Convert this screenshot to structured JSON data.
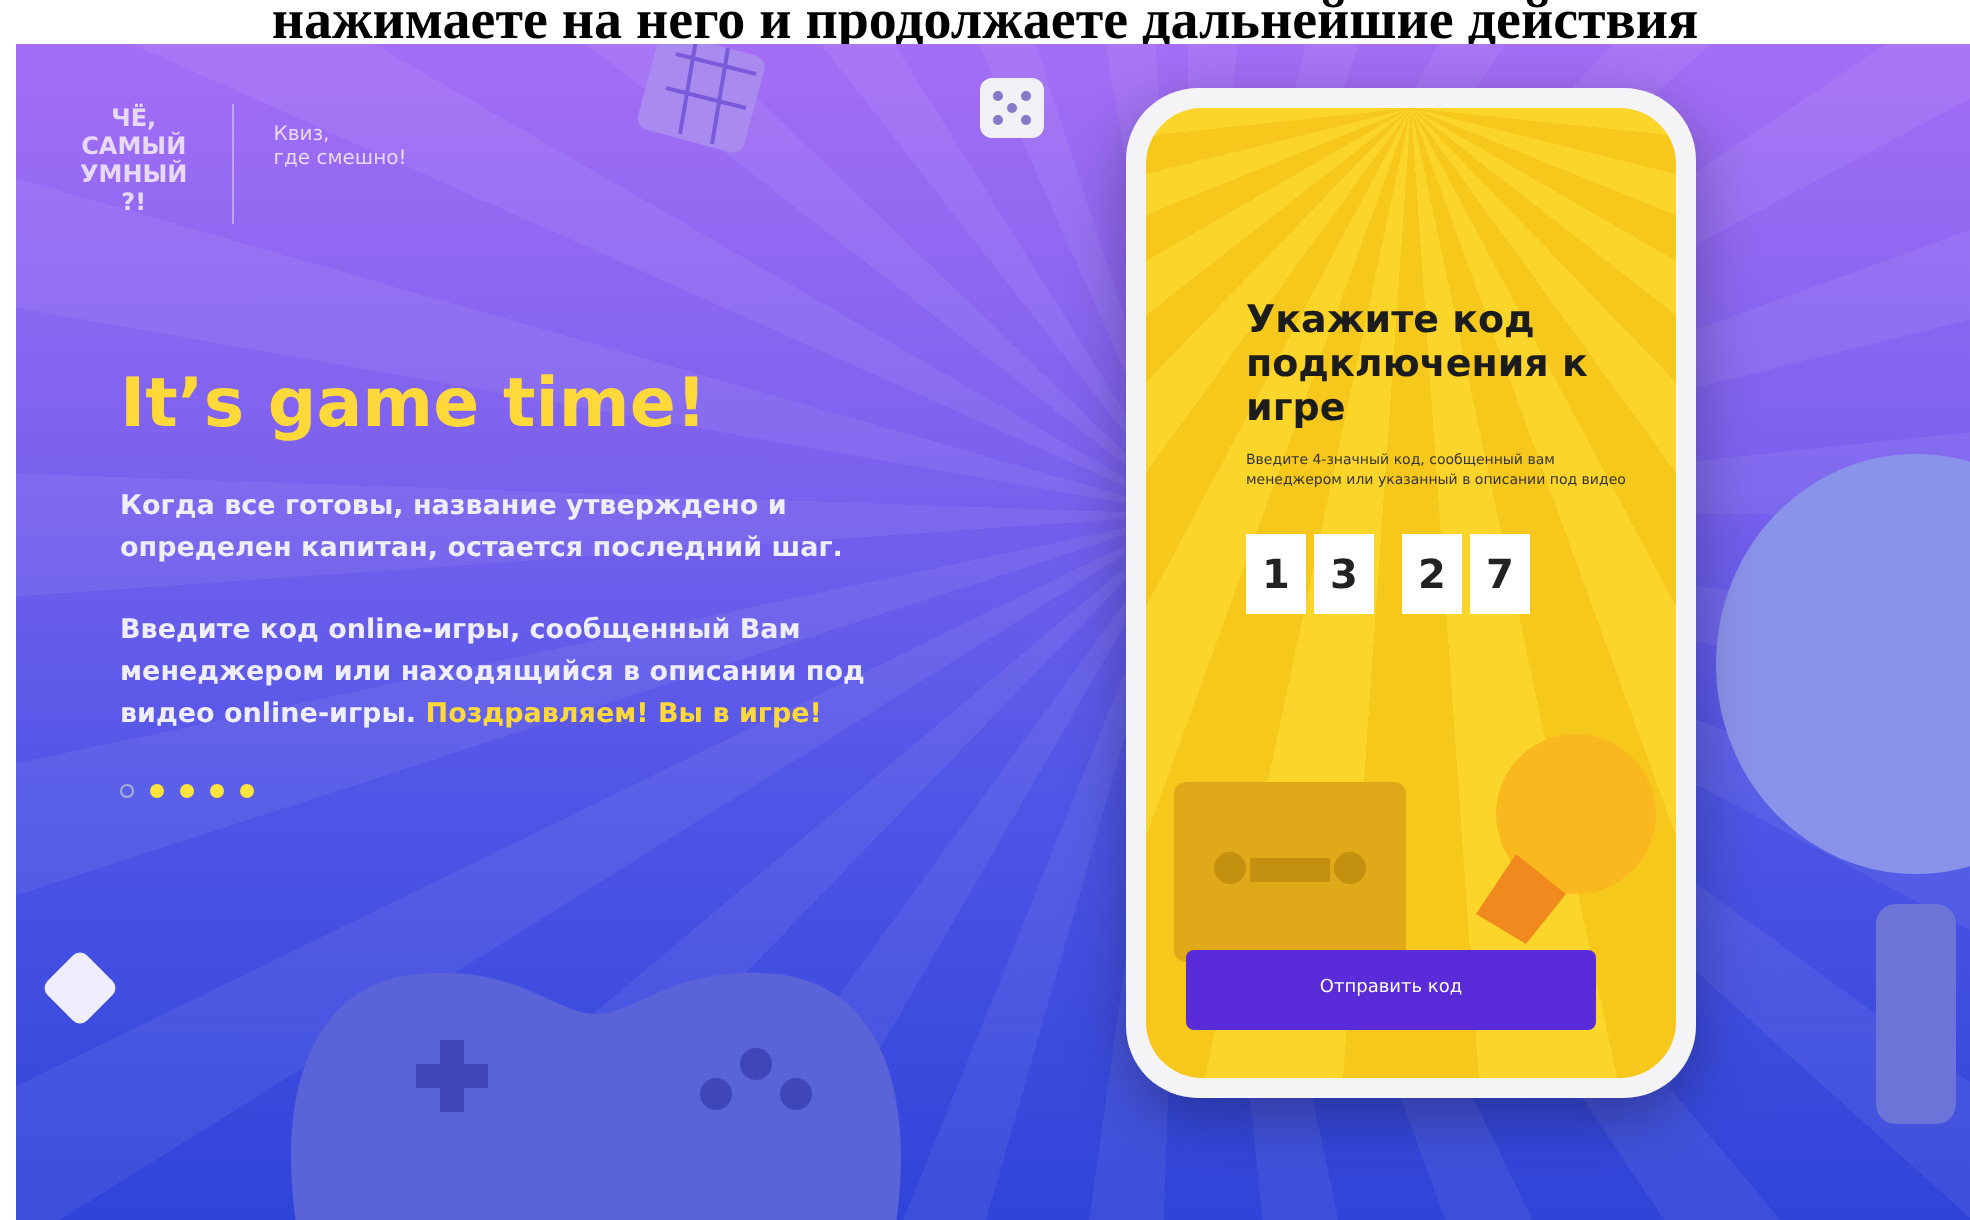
{
  "caption": "нажимаете на него и продолжаете дальнейшие действия",
  "banner": {
    "logo": {
      "lines": [
        "ЧЁ,",
        "САМЫЙ",
        "УМНЫЙ",
        "?!"
      ]
    },
    "tagline": [
      "Квиз,",
      "где смешно!"
    ],
    "headline": "It’s game time!",
    "paragraphs": [
      "Когда все готовы, название утверждено и определен капитан, остается последний шаг.",
      "Введите код online-игры, сообщенный Вам менеджером или находящийся в описании под видео online-игры. **Поздравляем! Вы в игре!**"
    ],
    "dots": [
      {
        "selected": true
      },
      {
        "selected": false
      },
      {
        "selected": false
      },
      {
        "selected": false
      },
      {
        "selected": false
      }
    ],
    "phone": {
      "title": "Укажите код подключения к игре",
      "hint": "Введите 4-значный код, сообщенный вам менеджером или указанный в описании под видео",
      "code": [
        "1",
        "3",
        "2",
        "7"
      ],
      "button": "Отправить код"
    }
  }
}
